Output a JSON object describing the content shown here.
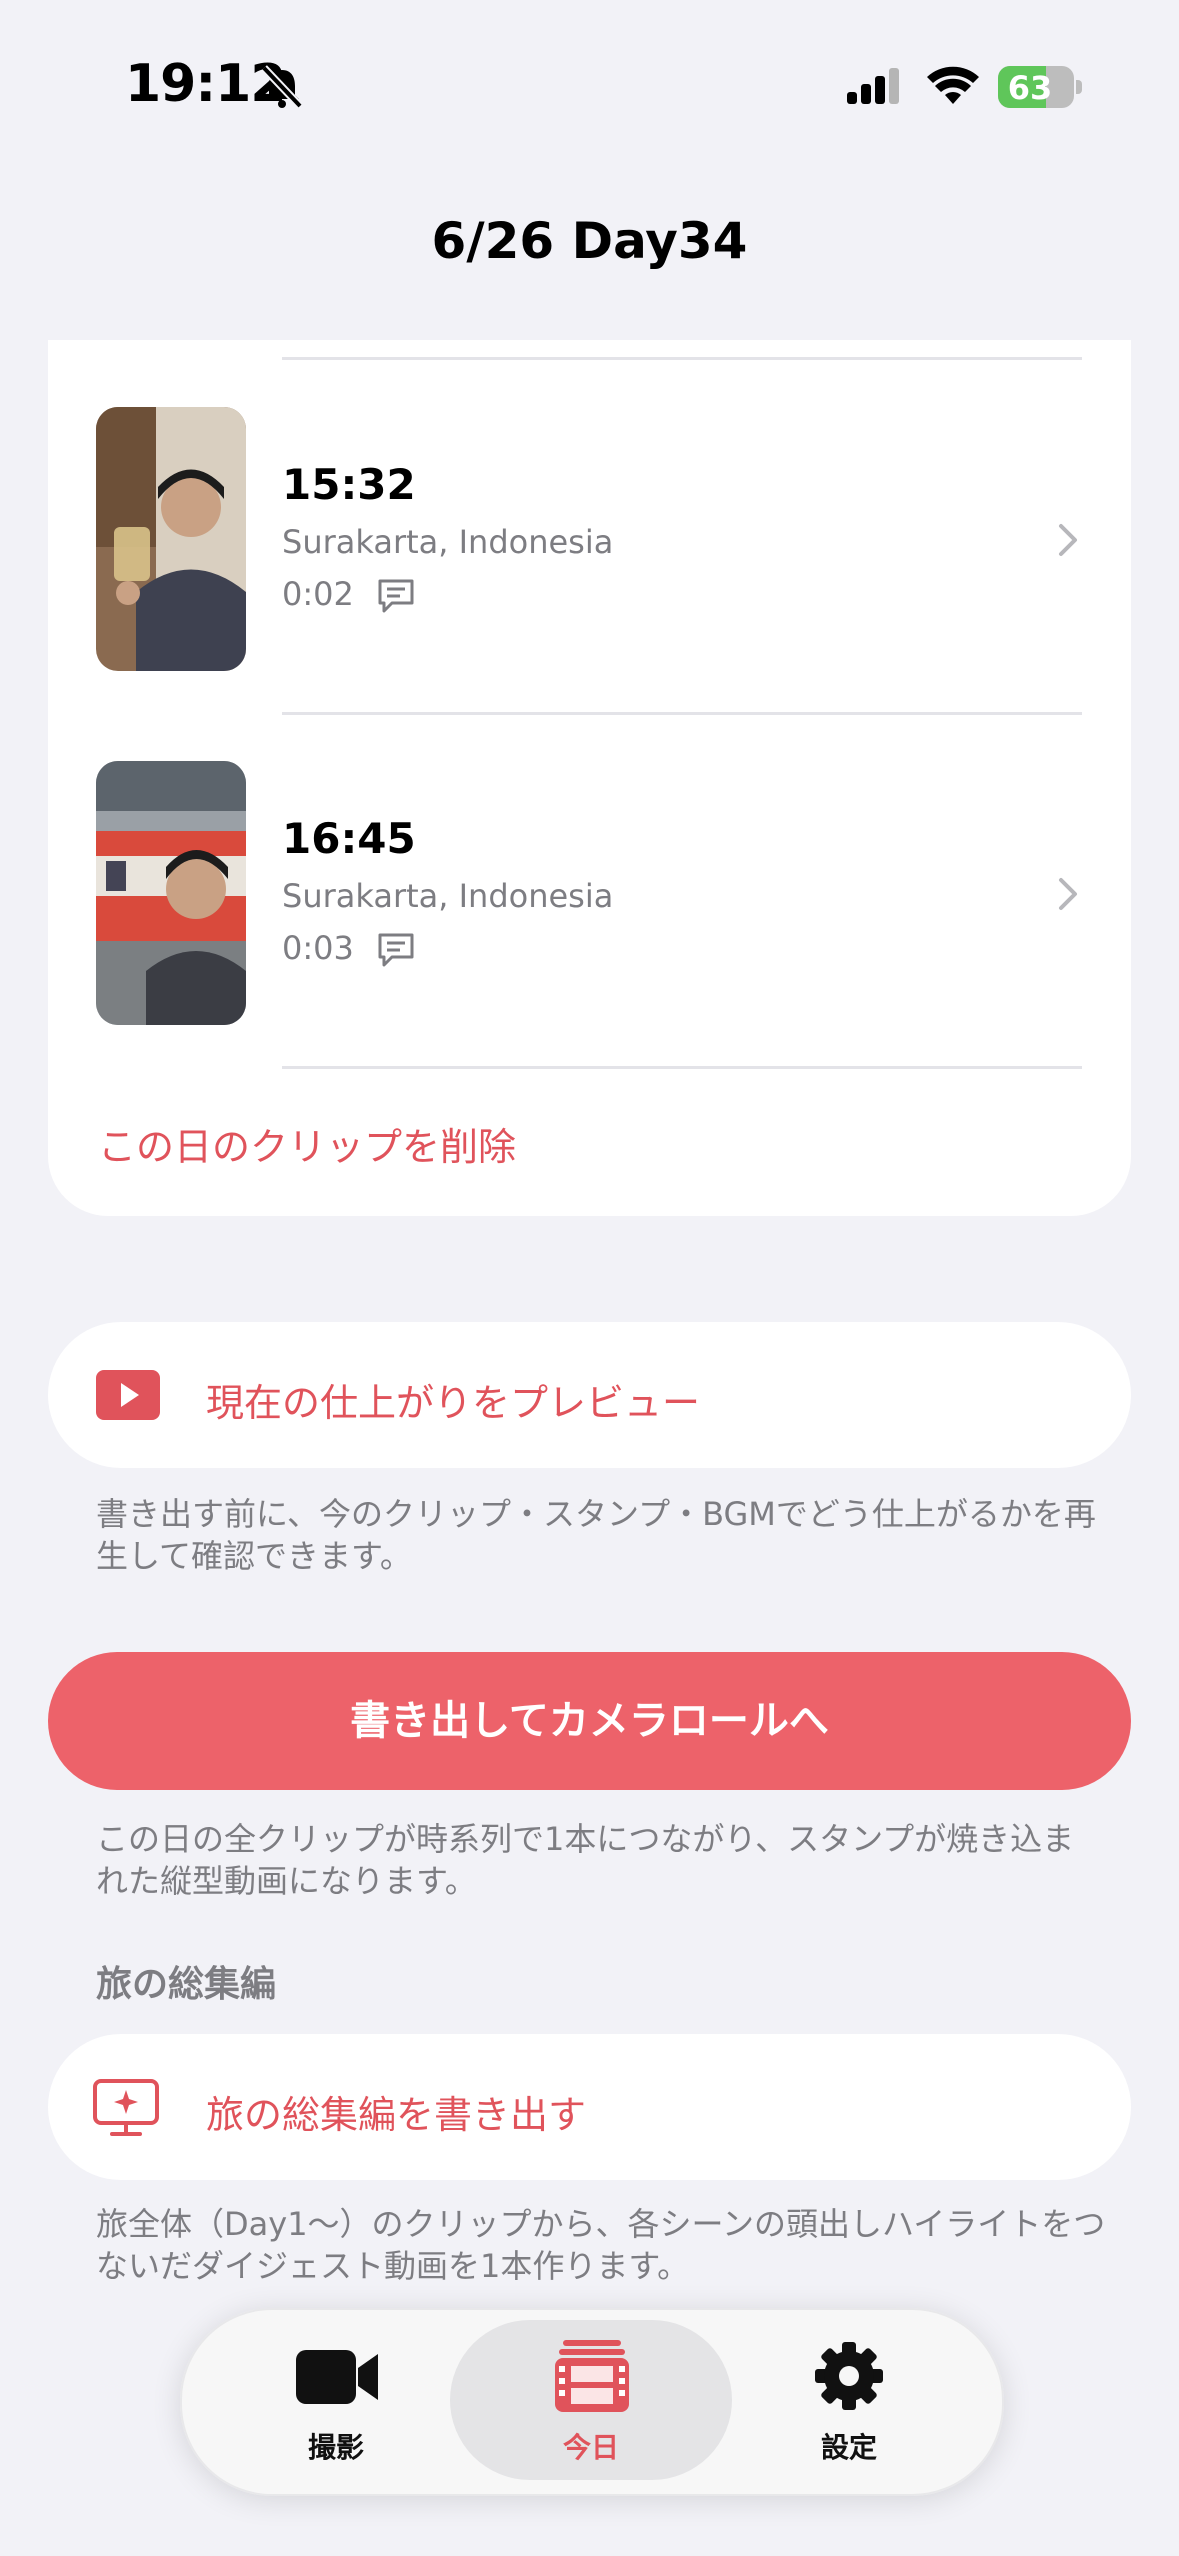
{
  "status_bar": {
    "time": "19:12",
    "battery": "63",
    "battery_level": 0.63
  },
  "nav": {
    "title": "6/26 Day34"
  },
  "clips": [
    {
      "time": "15:32",
      "location": "Surakarta, Indonesia",
      "duration": "0:02"
    },
    {
      "time": "16:45",
      "location": "Surakarta, Indonesia",
      "duration": "0:03"
    }
  ],
  "delete_label": "この日のクリップを削除",
  "preview": {
    "label": "現在の仕上がりをプレビュー",
    "note": "書き出す前に、今のクリップ・スタンプ・BGMでどう仕上がるかを再生して確認できます。"
  },
  "export": {
    "label": "書き出してカメラロールへ",
    "note": "この日の全クリップが時系列で1本につながり、スタンプが焼き込まれた縦型動画になります。"
  },
  "digest": {
    "section_title": "旅の総集編",
    "label": "旅の総集編を書き出す",
    "note": "旅全体（Day1〜）のクリップから、各シーンの頭出しハイライトをつないだダイジェスト動画を1本作ります。"
  },
  "tabs": [
    {
      "label": "撮影",
      "icon": "video-camera-icon"
    },
    {
      "label": "今日",
      "icon": "film-strip-icon"
    },
    {
      "label": "設定",
      "icon": "gear-icon"
    }
  ],
  "colors": {
    "accent": "#e0535b",
    "button": "#ed626a",
    "background": "#f2f2f7"
  }
}
